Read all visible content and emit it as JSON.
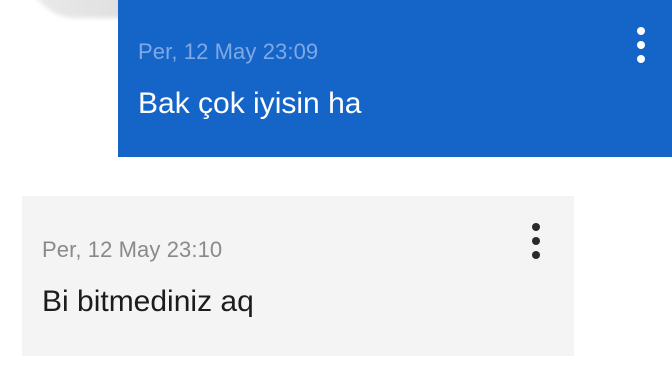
{
  "messages": [
    {
      "direction": "sent",
      "timestamp": "Per, 12 May 23:09",
      "text": "Bak çok iyisin ha",
      "more_icon": "more-vert-icon"
    },
    {
      "direction": "received",
      "timestamp": "Per, 12 May 23:10",
      "text": "Bi bitmediniz aq",
      "more_icon": "more-vert-icon"
    }
  ],
  "colors": {
    "sent_bubble": "#1565c8",
    "received_bubble": "#f4f4f4",
    "sent_timestamp": "#7fa9e6",
    "received_timestamp": "#8a8a8a"
  }
}
